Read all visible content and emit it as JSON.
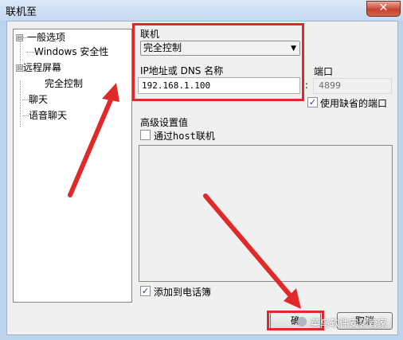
{
  "window": {
    "title": "联机至",
    "close_glyph": "✕"
  },
  "tree": {
    "items": [
      {
        "label": "一般选项",
        "expander": "⊟"
      },
      {
        "label": "Windows 安全性"
      },
      {
        "label": "远程屏幕",
        "expander": "⊟"
      },
      {
        "label": "完全控制"
      },
      {
        "label": "聊天"
      },
      {
        "label": "语音聊天"
      }
    ]
  },
  "connect": {
    "label": "联机",
    "mode_value": "完全控制",
    "address_label": "IP地址或 DNS 名称",
    "address_value": "192.168.1.100",
    "port_label": "端口",
    "port_separator": ":",
    "port_value": "4899",
    "default_port_label": "使用缺省的端口",
    "default_port_checked": true
  },
  "advanced": {
    "label": "高级设置值",
    "via_host_label": "通过host联机",
    "via_host_checked": false
  },
  "footer": {
    "add_to_phonebook_label": "添加到电话簿",
    "add_to_phonebook_checked": true,
    "ok_label": "确",
    "cancel_label": "取消"
  },
  "watermark": {
    "text": "菜鸟软件安装管家"
  },
  "colors": {
    "annotation_red": "#e02a2a",
    "titlebar": "#c5d9f0",
    "close_button": "#c7432f"
  }
}
